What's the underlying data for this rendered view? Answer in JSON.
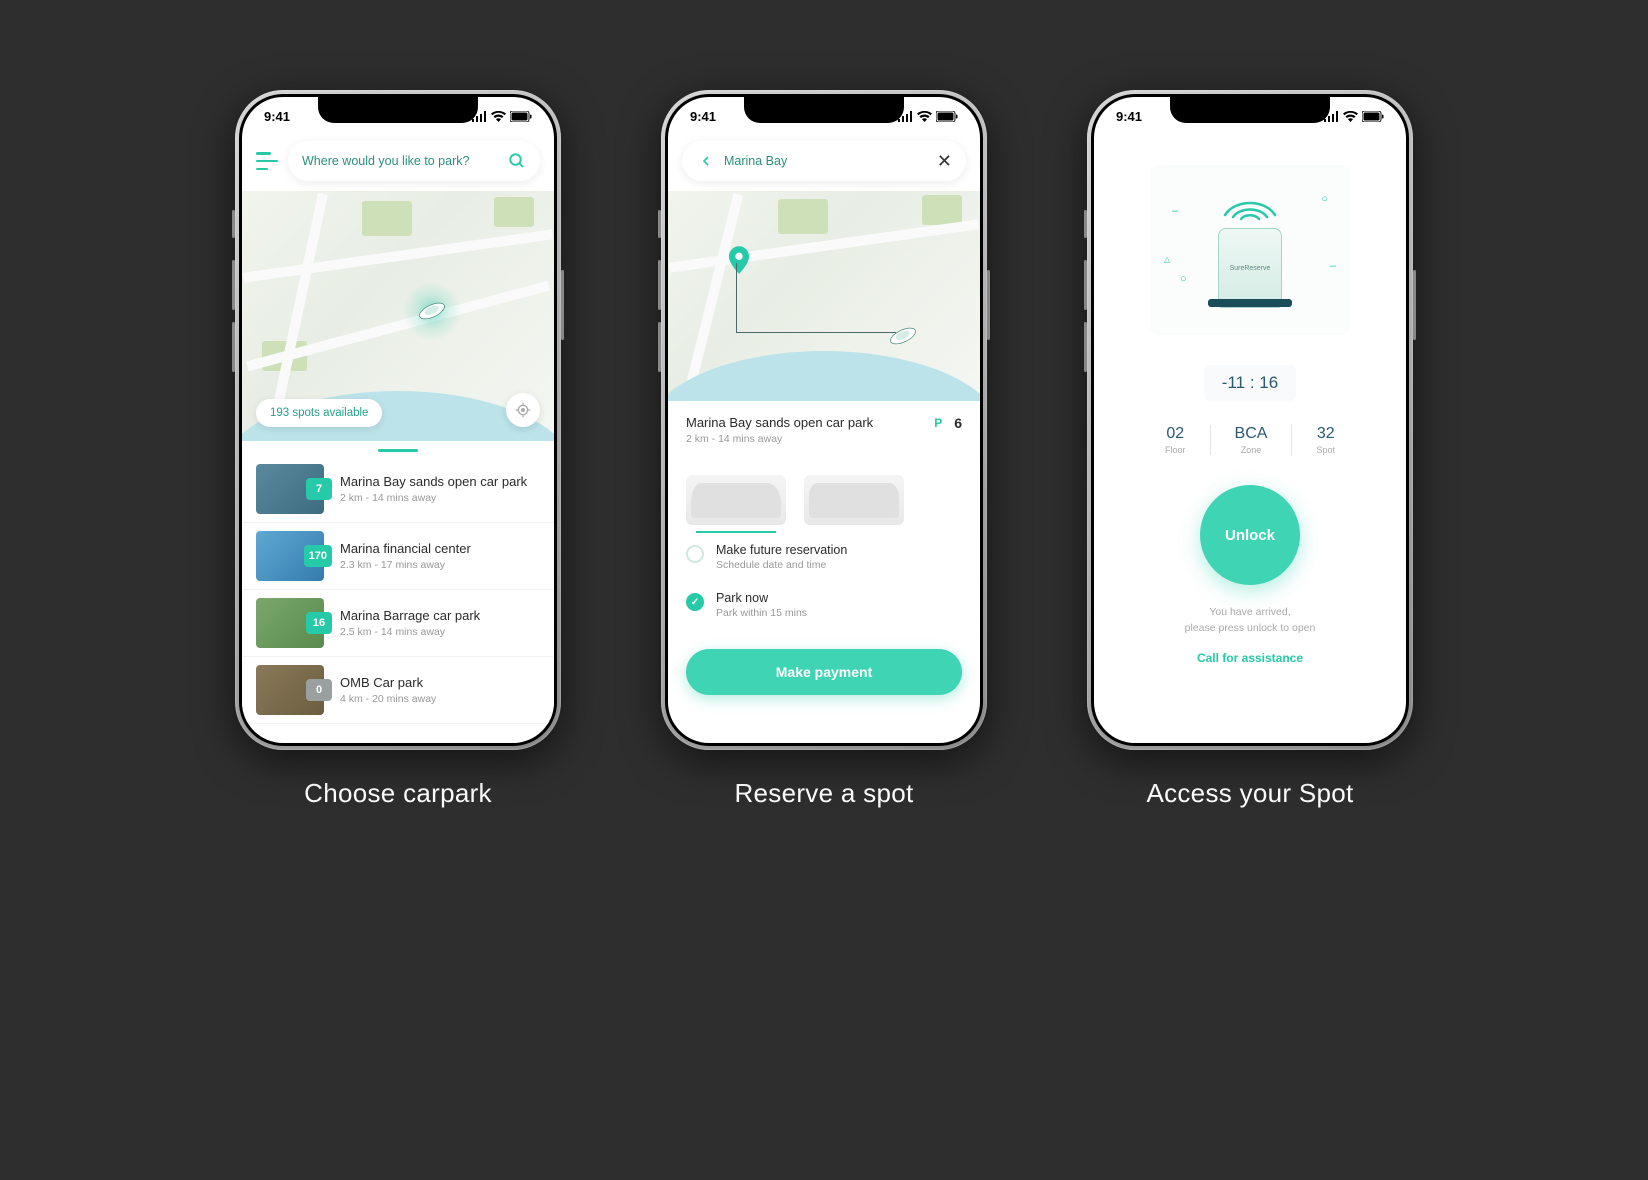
{
  "status_time": "9:41",
  "captions": {
    "choose": "Choose carpark",
    "reserve": "Reserve a spot",
    "access": "Access your Spot"
  },
  "screen1": {
    "search_placeholder": "Where would you like to park?",
    "spots_available": "193 spots available",
    "carparks": [
      {
        "name": "Marina Bay sands open car park",
        "meta": "2 km - 14 mins away",
        "count": "7"
      },
      {
        "name": "Marina financial center",
        "meta": "2.3 km - 17 mins away",
        "count": "170"
      },
      {
        "name": "Marina Barrage car park",
        "meta": "2.5 km - 14 mins away",
        "count": "16"
      },
      {
        "name": "OMB Car park",
        "meta": "4 km - 20 mins away",
        "count": "0"
      }
    ]
  },
  "screen2": {
    "search_value": "Marina Bay",
    "selected": {
      "name": "Marina Bay sands open car park",
      "meta": "2 km - 14 mins away",
      "p_label": "P",
      "count": "6"
    },
    "options": [
      {
        "title": "Make future reservation",
        "sub": "Schedule date and time"
      },
      {
        "title": "Park now",
        "sub": "Park within 15 mins"
      }
    ],
    "pay_label": "Make payment"
  },
  "screen3": {
    "device_label": "SureReserve",
    "timer": "-11 : 16",
    "location": [
      {
        "val": "02",
        "label": "Floor"
      },
      {
        "val": "BCA",
        "label": "Zone"
      },
      {
        "val": "32",
        "label": "Spot"
      }
    ],
    "unlock_label": "Unlock",
    "arrive_line1": "You have arrived,",
    "arrive_line2": "please press unlock to open",
    "assist": "Call for assistance"
  }
}
